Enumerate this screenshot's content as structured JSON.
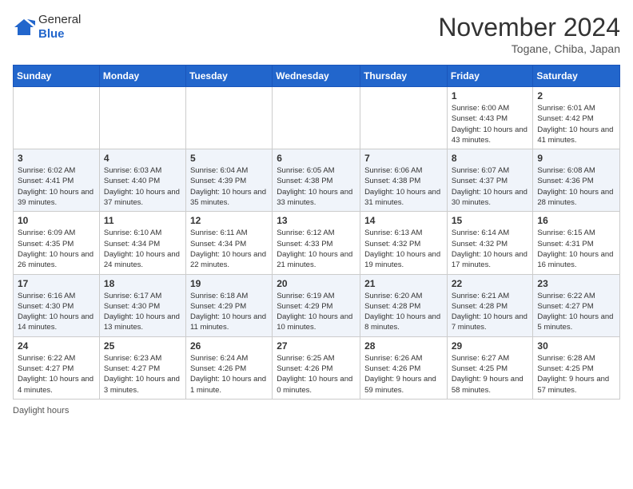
{
  "logo": {
    "general": "General",
    "blue": "Blue"
  },
  "header": {
    "month_title": "November 2024",
    "location": "Togane, Chiba, Japan"
  },
  "days_of_week": [
    "Sunday",
    "Monday",
    "Tuesday",
    "Wednesday",
    "Thursday",
    "Friday",
    "Saturday"
  ],
  "weeks": [
    [
      {
        "day": "",
        "info": ""
      },
      {
        "day": "",
        "info": ""
      },
      {
        "day": "",
        "info": ""
      },
      {
        "day": "",
        "info": ""
      },
      {
        "day": "",
        "info": ""
      },
      {
        "day": "1",
        "info": "Sunrise: 6:00 AM\nSunset: 4:43 PM\nDaylight: 10 hours and 43 minutes."
      },
      {
        "day": "2",
        "info": "Sunrise: 6:01 AM\nSunset: 4:42 PM\nDaylight: 10 hours and 41 minutes."
      }
    ],
    [
      {
        "day": "3",
        "info": "Sunrise: 6:02 AM\nSunset: 4:41 PM\nDaylight: 10 hours and 39 minutes."
      },
      {
        "day": "4",
        "info": "Sunrise: 6:03 AM\nSunset: 4:40 PM\nDaylight: 10 hours and 37 minutes."
      },
      {
        "day": "5",
        "info": "Sunrise: 6:04 AM\nSunset: 4:39 PM\nDaylight: 10 hours and 35 minutes."
      },
      {
        "day": "6",
        "info": "Sunrise: 6:05 AM\nSunset: 4:38 PM\nDaylight: 10 hours and 33 minutes."
      },
      {
        "day": "7",
        "info": "Sunrise: 6:06 AM\nSunset: 4:38 PM\nDaylight: 10 hours and 31 minutes."
      },
      {
        "day": "8",
        "info": "Sunrise: 6:07 AM\nSunset: 4:37 PM\nDaylight: 10 hours and 30 minutes."
      },
      {
        "day": "9",
        "info": "Sunrise: 6:08 AM\nSunset: 4:36 PM\nDaylight: 10 hours and 28 minutes."
      }
    ],
    [
      {
        "day": "10",
        "info": "Sunrise: 6:09 AM\nSunset: 4:35 PM\nDaylight: 10 hours and 26 minutes."
      },
      {
        "day": "11",
        "info": "Sunrise: 6:10 AM\nSunset: 4:34 PM\nDaylight: 10 hours and 24 minutes."
      },
      {
        "day": "12",
        "info": "Sunrise: 6:11 AM\nSunset: 4:34 PM\nDaylight: 10 hours and 22 minutes."
      },
      {
        "day": "13",
        "info": "Sunrise: 6:12 AM\nSunset: 4:33 PM\nDaylight: 10 hours and 21 minutes."
      },
      {
        "day": "14",
        "info": "Sunrise: 6:13 AM\nSunset: 4:32 PM\nDaylight: 10 hours and 19 minutes."
      },
      {
        "day": "15",
        "info": "Sunrise: 6:14 AM\nSunset: 4:32 PM\nDaylight: 10 hours and 17 minutes."
      },
      {
        "day": "16",
        "info": "Sunrise: 6:15 AM\nSunset: 4:31 PM\nDaylight: 10 hours and 16 minutes."
      }
    ],
    [
      {
        "day": "17",
        "info": "Sunrise: 6:16 AM\nSunset: 4:30 PM\nDaylight: 10 hours and 14 minutes."
      },
      {
        "day": "18",
        "info": "Sunrise: 6:17 AM\nSunset: 4:30 PM\nDaylight: 10 hours and 13 minutes."
      },
      {
        "day": "19",
        "info": "Sunrise: 6:18 AM\nSunset: 4:29 PM\nDaylight: 10 hours and 11 minutes."
      },
      {
        "day": "20",
        "info": "Sunrise: 6:19 AM\nSunset: 4:29 PM\nDaylight: 10 hours and 10 minutes."
      },
      {
        "day": "21",
        "info": "Sunrise: 6:20 AM\nSunset: 4:28 PM\nDaylight: 10 hours and 8 minutes."
      },
      {
        "day": "22",
        "info": "Sunrise: 6:21 AM\nSunset: 4:28 PM\nDaylight: 10 hours and 7 minutes."
      },
      {
        "day": "23",
        "info": "Sunrise: 6:22 AM\nSunset: 4:27 PM\nDaylight: 10 hours and 5 minutes."
      }
    ],
    [
      {
        "day": "24",
        "info": "Sunrise: 6:22 AM\nSunset: 4:27 PM\nDaylight: 10 hours and 4 minutes."
      },
      {
        "day": "25",
        "info": "Sunrise: 6:23 AM\nSunset: 4:27 PM\nDaylight: 10 hours and 3 minutes."
      },
      {
        "day": "26",
        "info": "Sunrise: 6:24 AM\nSunset: 4:26 PM\nDaylight: 10 hours and 1 minute."
      },
      {
        "day": "27",
        "info": "Sunrise: 6:25 AM\nSunset: 4:26 PM\nDaylight: 10 hours and 0 minutes."
      },
      {
        "day": "28",
        "info": "Sunrise: 6:26 AM\nSunset: 4:26 PM\nDaylight: 9 hours and 59 minutes."
      },
      {
        "day": "29",
        "info": "Sunrise: 6:27 AM\nSunset: 4:25 PM\nDaylight: 9 hours and 58 minutes."
      },
      {
        "day": "30",
        "info": "Sunrise: 6:28 AM\nSunset: 4:25 PM\nDaylight: 9 hours and 57 minutes."
      }
    ]
  ],
  "footer": {
    "daylight_label": "Daylight hours"
  }
}
